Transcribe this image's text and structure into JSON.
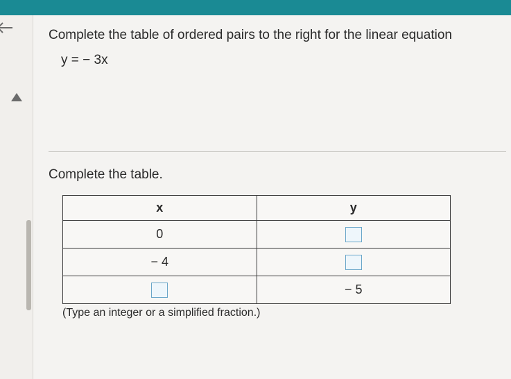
{
  "problem": {
    "instruction": "Complete the table of ordered pairs to the right for the linear equation",
    "equation": "y = − 3x"
  },
  "section": {
    "label": "Complete the table."
  },
  "chart_data": {
    "type": "table",
    "columns": [
      "x",
      "y"
    ],
    "rows": [
      {
        "x": "0",
        "y": ""
      },
      {
        "x": "− 4",
        "y": ""
      },
      {
        "x": "",
        "y": "− 5"
      }
    ]
  },
  "hint": "(Type an integer or a simplified fraction.)"
}
